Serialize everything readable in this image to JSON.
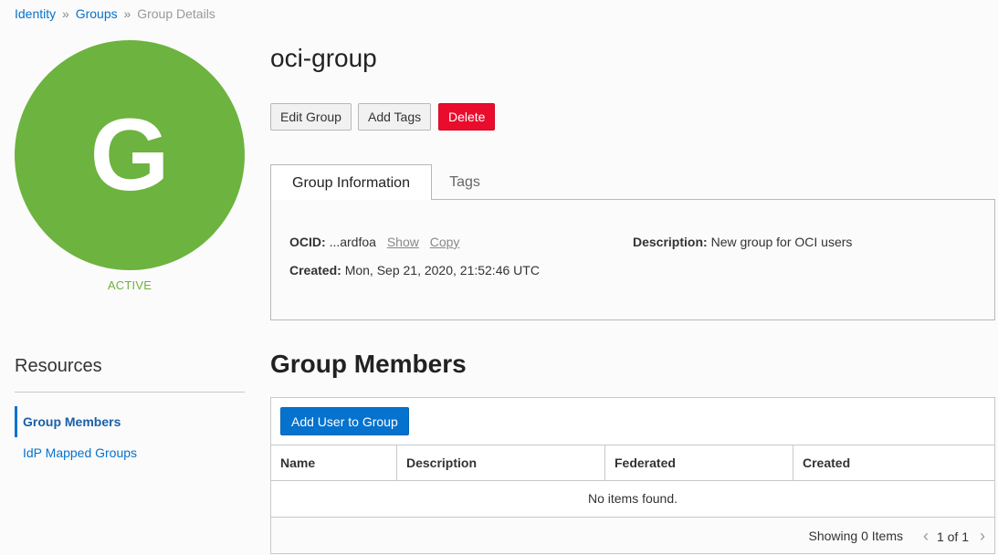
{
  "breadcrumb": {
    "items": [
      "Identity",
      "Groups"
    ],
    "separator": "»",
    "current": "Group Details"
  },
  "avatar": {
    "letter": "G",
    "color": "#6db33f"
  },
  "status": "ACTIVE",
  "resources": {
    "title": "Resources",
    "items": [
      {
        "label": "Group Members",
        "active": true
      },
      {
        "label": "IdP Mapped Groups",
        "active": false
      }
    ]
  },
  "group": {
    "name": "oci-group"
  },
  "actions": {
    "edit": "Edit Group",
    "add_tags": "Add Tags",
    "delete": "Delete"
  },
  "tabs": [
    "Group Information",
    "Tags"
  ],
  "info": {
    "ocid_label": "OCID:",
    "ocid_value": "...ardfoa",
    "show": "Show",
    "copy": "Copy",
    "created_label": "Created:",
    "created_value": "Mon, Sep 21, 2020, 21:52:46 UTC",
    "description_label": "Description:",
    "description_value": "New group for OCI users"
  },
  "members": {
    "title": "Group Members",
    "add_button": "Add User to Group",
    "columns": [
      "Name",
      "Description",
      "Federated",
      "Created"
    ],
    "empty_text": "No items found.",
    "showing": "Showing 0 Items",
    "pager": "1 of 1",
    "prev_icon": "chevron-left-icon",
    "next_icon": "chevron-right-icon"
  },
  "colors": {
    "accent": "#0572ce",
    "danger": "#ea0c2c",
    "active": "#6db33f"
  }
}
